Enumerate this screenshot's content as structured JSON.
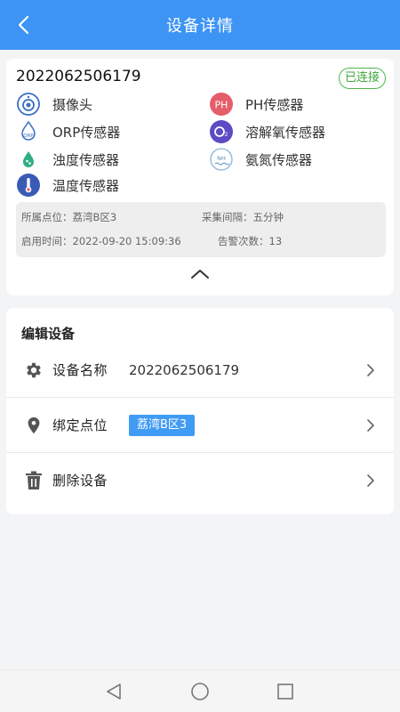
{
  "header": {
    "title": "设备详情"
  },
  "device": {
    "id": "2022062506179",
    "status": "已连接",
    "status_color": "#4cb84c",
    "sensors": [
      {
        "label": "摄像头",
        "icon": "camera-icon"
      },
      {
        "label": "PH传感器",
        "icon": "ph-icon"
      },
      {
        "label": "ORP传感器",
        "icon": "orp-icon"
      },
      {
        "label": "溶解氧传感器",
        "icon": "oxygen-icon"
      },
      {
        "label": "浊度传感器",
        "icon": "turbidity-icon"
      },
      {
        "label": "氨氮传感器",
        "icon": "ammonia-icon"
      },
      {
        "label": "温度传感器",
        "icon": "thermometer-icon"
      }
    ],
    "info": {
      "location_label": "所属点位：",
      "location_value": "荔湾B区3",
      "interval_label": "采集间隔：",
      "interval_value": "五分钟",
      "enabled_label": "启用时间：",
      "enabled_value": "2022-09-20 15:09:36",
      "alarm_label": "告警次数：",
      "alarm_value": "13"
    }
  },
  "edit": {
    "section_title": "编辑设备",
    "name_label": "设备名称",
    "name_value": "2022062506179",
    "bind_label": "绑定点位",
    "bind_value": "荔湾B区3",
    "delete_label": "删除设备"
  },
  "colors": {
    "primary": "#3d94f4",
    "tag": "#409bf5",
    "ph": "#e45d6a",
    "oxygen": "#5b4bc4",
    "thermo": "#3a5bb5"
  }
}
